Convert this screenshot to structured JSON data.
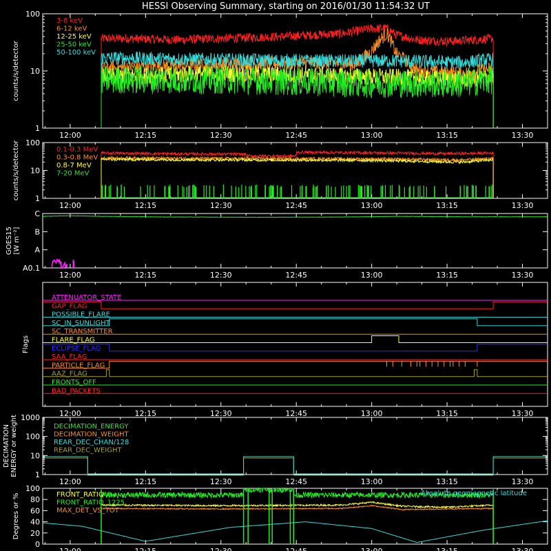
{
  "title": "HESSI Observing Summary, starting on 2016/01/30 11:54:32 UT",
  "time_ticks": [
    "12:00",
    "12:15",
    "12:30",
    "12:45",
    "13:00",
    "13:15",
    "13:30"
  ],
  "colors": {
    "red": "#ff2020",
    "orange": "#ff8c1a",
    "yellow": "#ffff33",
    "green": "#22ee22",
    "cyan": "#33dddd",
    "magenta": "#ff22ff",
    "blue": "#2a2aff",
    "olive": "#a39f2a",
    "white": "#ffffff"
  },
  "chart_data": [
    {
      "type": "line",
      "name": "panel-low-energy",
      "ylabel": "counts/s/detector",
      "ylog": true,
      "ylim": [
        1,
        100
      ],
      "yticks": [
        "1",
        "10",
        "100"
      ],
      "xlim": [
        11.9089,
        13.5833
      ],
      "legend": [
        {
          "label": "3-6 keV",
          "color": "#ff2020"
        },
        {
          "label": "6-12 keV",
          "color": "#ff8c1a"
        },
        {
          "label": "12-25 keV",
          "color": "#ffff33"
        },
        {
          "label": "25-50 keV",
          "color": "#22ee22"
        },
        {
          "label": "50-100 keV",
          "color": "#33dddd"
        }
      ],
      "series": [
        {
          "color": "#ff2020",
          "x": [
            12.103,
            12.2,
            12.35,
            12.5,
            12.7,
            12.9,
            13.0,
            13.05,
            13.08,
            13.15,
            13.25,
            13.3,
            13.403
          ],
          "y": [
            37,
            37,
            35,
            37,
            40,
            45,
            55,
            56,
            43,
            35,
            33,
            34,
            37
          ],
          "noise": 0.08
        },
        {
          "color": "#ff8c1a",
          "x": [
            12.103,
            12.25,
            12.5,
            12.8,
            12.95,
            13.0,
            13.05,
            13.08,
            13.15,
            13.3,
            13.403
          ],
          "y": [
            11,
            12,
            13,
            14,
            13,
            22,
            45,
            20,
            10,
            9,
            11
          ],
          "noise": 0.12
        },
        {
          "color": "#33dddd",
          "x": [
            12.103,
            12.4,
            12.8,
            13.1,
            13.3,
            13.403
          ],
          "y": [
            17,
            16,
            15,
            15,
            14,
            16
          ],
          "noise": 0.12
        },
        {
          "color": "#ffff33",
          "x": [
            12.103,
            12.5,
            13.0,
            13.3,
            13.403
          ],
          "y": [
            8,
            9,
            8,
            7,
            8
          ],
          "noise": 0.15
        },
        {
          "color": "#22ee22",
          "x": [
            12.103,
            12.5,
            13.0,
            13.3,
            13.403
          ],
          "y": [
            7,
            7,
            6,
            6,
            7
          ],
          "noise": 0.25
        }
      ]
    },
    {
      "type": "line",
      "name": "panel-high-energy",
      "ylabel": "counts/s/detector",
      "ylog": true,
      "ylim": [
        1,
        100
      ],
      "yticks": [
        "1",
        "10",
        "100"
      ],
      "xlim": [
        11.9089,
        13.5833
      ],
      "legend": [
        {
          "label": "0.1-0.3 MeV",
          "color": "#ff2020"
        },
        {
          "label": "0.3-0.8 MeV",
          "color": "#ff8c1a"
        },
        {
          "label": "0.8-7 MeV",
          "color": "#ffff33"
        },
        {
          "label": "7-20 MeV",
          "color": "#22ee22"
        }
      ],
      "series": [
        {
          "color": "#ff2020",
          "x": [
            12.103,
            12.3,
            12.5833,
            12.5834,
            12.75,
            12.7501,
            13.0,
            13.25,
            13.403
          ],
          "y": [
            42,
            40,
            38,
            33,
            33,
            45,
            43,
            40,
            42
          ],
          "noise": 0.05
        },
        {
          "color": "#ff8c1a",
          "x": [
            12.103,
            12.5,
            13.0,
            13.3,
            13.403
          ],
          "y": [
            28,
            27,
            26,
            24,
            27
          ],
          "noise": 0.05
        },
        {
          "color": "#ffff33",
          "x": [
            12.103,
            12.5,
            13.0,
            13.3,
            13.403
          ],
          "y": [
            25,
            24,
            23,
            20,
            24
          ],
          "noise": 0.05
        }
      ],
      "spikes": {
        "color": "#22ee22",
        "x_range": [
          12.103,
          13.403
        ],
        "base": 1,
        "top": 2.5,
        "count": 130
      }
    },
    {
      "type": "line",
      "name": "panel-goes",
      "ylabel": "GOES15 [W m⁻²]",
      "ylog": true,
      "ylim": [
        1e-09,
        1e-06
      ],
      "yticks": [
        "A0.1",
        "A",
        "B",
        "C"
      ],
      "xlim": [
        11.9089,
        13.5833
      ],
      "series": [
        {
          "color": "#22ee22",
          "x": [
            11.909,
            12.0,
            12.1,
            12.3,
            12.6,
            12.9,
            13.1,
            13.3,
            13.583
          ],
          "y": [
            7e-07,
            7.5e-07,
            7e-07,
            6.5e-07,
            6.2e-07,
            6.4e-07,
            7e-07,
            6.6e-07,
            6.6e-07
          ],
          "noise": 0.01
        }
      ],
      "bursts": {
        "color": "#ff22ff",
        "segments": [
          [
            11.94,
            11.97,
            2.5e-09
          ],
          [
            11.975,
            11.99,
            1.8e-09
          ],
          [
            12.01,
            12.013,
            2.5e-09
          ]
        ]
      }
    },
    {
      "type": "step",
      "name": "panel-flags",
      "ylabel": "Flags",
      "xlim": [
        11.9089,
        13.5833
      ],
      "flags": [
        {
          "label": "ATTENUATOR_STATE",
          "color": "#ff22ff",
          "steps": []
        },
        {
          "label": "GAP_FLAG",
          "color": "#ff2020",
          "steps": [
            [
              11.909,
              12.103,
              1
            ],
            [
              12.103,
              13.403,
              0
            ],
            [
              13.403,
              13.583,
              1
            ]
          ]
        },
        {
          "label": "POSSIBLE_FLARE",
          "color": "#33dddd",
          "steps": []
        },
        {
          "label": "SC_IN_SUNLIGHT",
          "color": "#33dddd",
          "steps": [
            [
              11.909,
              12.13,
              0
            ],
            [
              12.13,
              13.35,
              1
            ],
            [
              13.35,
              13.583,
              0
            ]
          ]
        },
        {
          "label": "SC_TRANSMITTER",
          "color": "#ff8c1a",
          "steps": []
        },
        {
          "label": "FLARE_FLAG",
          "color": "#ffff33",
          "steps": [
            [
              11.909,
              13.0,
              0
            ],
            [
              13.0,
              13.09,
              1
            ],
            [
              13.09,
              13.583,
              0
            ]
          ]
        },
        {
          "label": "ECLIPSE_FLAG",
          "color": "#2a2aff",
          "steps": [
            [
              11.909,
              12.13,
              1
            ],
            [
              12.13,
              13.35,
              0
            ],
            [
              13.35,
              13.583,
              1
            ]
          ]
        },
        {
          "label": "SAA_FLAG",
          "color": "#ff2020",
          "steps": []
        },
        {
          "label": "PARTICLE_FLAG",
          "color": "#ff8c1a",
          "steps": [
            [
              11.909,
              12.13,
              0
            ],
            [
              12.13,
              13.583,
              1
            ]
          ],
          "pulses": [
            13.05,
            13.07,
            13.1,
            13.13,
            13.15,
            13.16,
            13.18,
            13.2,
            13.22,
            13.24,
            13.26,
            13.27,
            13.29,
            13.31,
            13.35
          ]
        },
        {
          "label": "AAZ_FLAG",
          "color": "#a39f2a",
          "steps": [
            [
              11.909,
              12.12,
              0
            ],
            [
              12.12,
              12.13,
              1
            ],
            [
              12.13,
              13.34,
              0
            ],
            [
              13.34,
              13.35,
              1
            ],
            [
              13.35,
              13.583,
              0
            ]
          ]
        },
        {
          "label": "FRONTS_OFF",
          "color": "#22ee22",
          "steps": []
        },
        {
          "label": "BAD_PACKETS",
          "color": "#ff2020",
          "steps": []
        }
      ]
    },
    {
      "type": "step",
      "name": "panel-decimation",
      "ylabel": "DECIMATION ENERGY or weight",
      "ylog": true,
      "ylim": [
        1,
        1000
      ],
      "yticks": [
        "1",
        "10",
        "100",
        "1000"
      ],
      "xlim": [
        11.9089,
        13.5833
      ],
      "legend": [
        {
          "label": "DECIMATION_ENERGY",
          "color": "#22ee22"
        },
        {
          "label": "DECIMATION_WEIGHT",
          "color": "#ff8c1a"
        },
        {
          "label": "REAR_DEC_CHAN/128",
          "color": "#33dddd"
        },
        {
          "label": "REAR_DEC_WEIGHT",
          "color": "#a39f2a"
        }
      ],
      "series": [
        {
          "color": "#a39f2a",
          "x": [
            11.909,
            12.058,
            12.058,
            12.575,
            12.575,
            12.741,
            12.741,
            13.403,
            13.403,
            13.583
          ],
          "y": [
            8,
            8,
            1,
            1,
            8,
            8,
            1,
            1,
            8,
            8
          ]
        },
        {
          "color": "#33dddd",
          "x": [
            11.909,
            12.058,
            12.058,
            12.575,
            12.575,
            12.741,
            12.741,
            13.403,
            13.403,
            13.583
          ],
          "y": [
            8,
            8,
            1,
            1,
            8,
            8,
            1,
            1,
            8,
            8
          ]
        }
      ]
    },
    {
      "type": "line",
      "name": "panel-ratios",
      "ylabel": "Degrees or %",
      "ylim": [
        0,
        100
      ],
      "yticks": [
        "0",
        "20",
        "40",
        "60",
        "80",
        "100"
      ],
      "xlim": [
        11.9089,
        13.5833
      ],
      "legend": [
        {
          "label": "FRONT_RATIO",
          "color": "#ffff33"
        },
        {
          "label": "FRONT_RATIO_1225",
          "color": "#22ee22"
        },
        {
          "label": "MAX_DET_VS_TOT",
          "color": "#ff8c1a"
        }
      ],
      "annotation": {
        "label": "Absolute geomagnetic latitude",
        "color": "#33dddd"
      },
      "series": [
        {
          "color": "#22ee22",
          "x": [
            12.103,
            12.575,
            12.575,
            12.741,
            12.741,
            13.403
          ],
          "y": [
            88,
            88,
            98,
            98,
            88,
            88
          ],
          "noise": 5
        },
        {
          "color": "#ffff33",
          "x": [
            12.103,
            12.5,
            12.9,
            13.0,
            13.1,
            13.25,
            13.403
          ],
          "y": [
            70,
            69,
            70,
            75,
            68,
            66,
            70
          ],
          "noise": 1.5
        },
        {
          "color": "#ff8c1a",
          "x": [
            12.103,
            12.5,
            12.9,
            13.0,
            13.1,
            13.403
          ],
          "y": [
            64,
            63,
            64,
            69,
            62,
            64
          ],
          "noise": 1
        },
        {
          "color": "#33dddd",
          "x": [
            11.909,
            12.04,
            12.25,
            12.53,
            12.78,
            13.0,
            13.15,
            13.37,
            13.583
          ],
          "y": [
            38,
            32,
            5,
            30,
            40,
            28,
            3,
            25,
            42
          ],
          "noise": 0
        }
      ],
      "verticals": {
        "color": "#22ee22",
        "x": [
          12.103,
          12.575,
          12.59,
          12.66,
          12.67,
          12.73,
          12.741,
          13.403
        ],
        "top": 98
      }
    }
  ]
}
